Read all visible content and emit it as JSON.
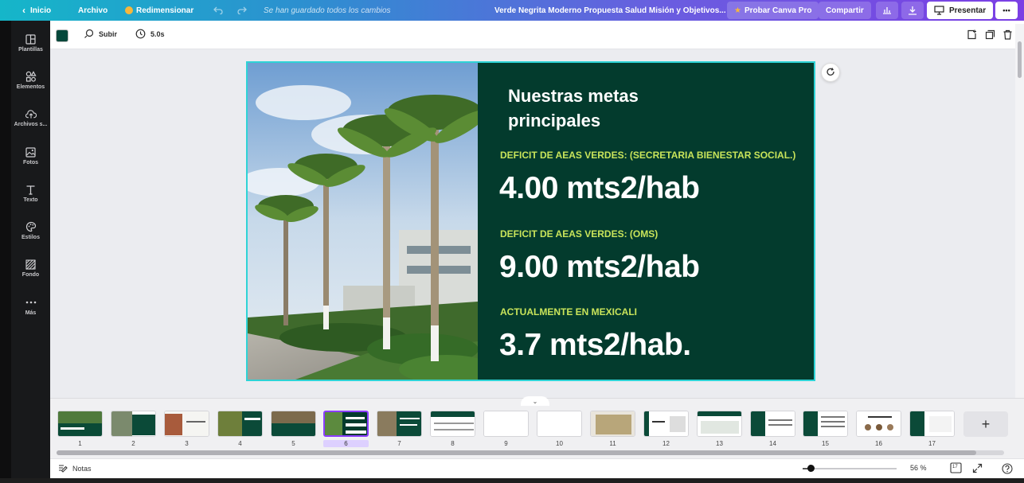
{
  "topbar": {
    "home": "Inicio",
    "file": "Archivo",
    "resize": "Redimensionar",
    "save_status": "Se han guardado todos los cambios",
    "doc_title": "Verde Negrita Moderno Propuesta Salud Misión y Objetivos...",
    "try_pro": "Probar Canva Pro",
    "share": "Compartir",
    "present": "Presentar",
    "more": "•••"
  },
  "sidebar": {
    "items": [
      {
        "label": "Plantillas",
        "icon": "templates-icon"
      },
      {
        "label": "Elementos",
        "icon": "elements-icon"
      },
      {
        "label": "Archivos s...",
        "icon": "uploads-icon"
      },
      {
        "label": "Fotos",
        "icon": "photos-icon"
      },
      {
        "label": "Texto",
        "icon": "text-icon"
      },
      {
        "label": "Estilos",
        "icon": "styles-icon"
      },
      {
        "label": "Fondo",
        "icon": "background-icon"
      },
      {
        "label": "Más",
        "icon": "more-icon"
      }
    ]
  },
  "context": {
    "color": "#04473a",
    "animate": "Subir",
    "duration": "5.0s"
  },
  "slide": {
    "title_line1": "Nuestras metas",
    "title_line2": "principales",
    "label1": "DEFICIT DE AEAS VERDES: (SECRETARIA  BIENESTAR SOCIAL.)",
    "value1": "4.00 mts2/hab",
    "label2": "DEFICIT DE AEAS VERDES: (OMS)",
    "value2": "9.00 mts2/hab",
    "label3": "ACTUALMENTE EN MEXICALI",
    "value3": "3.7 mts2/hab."
  },
  "thumbnails": {
    "pages": [
      "1",
      "2",
      "3",
      "4",
      "5",
      "6",
      "7",
      "8",
      "9",
      "10",
      "11",
      "12",
      "13",
      "14",
      "15",
      "16",
      "17"
    ],
    "active_page": "6",
    "add_label": "+"
  },
  "bottombar": {
    "notes": "Notas",
    "zoom": "56 %",
    "zoom_level": 0.56,
    "page_count_icon": "17"
  },
  "colors": {
    "accent": "#8b3dff",
    "slide_bg": "#033b2d",
    "slide_label": "#c9e45a",
    "selection": "#2ed3d6"
  }
}
